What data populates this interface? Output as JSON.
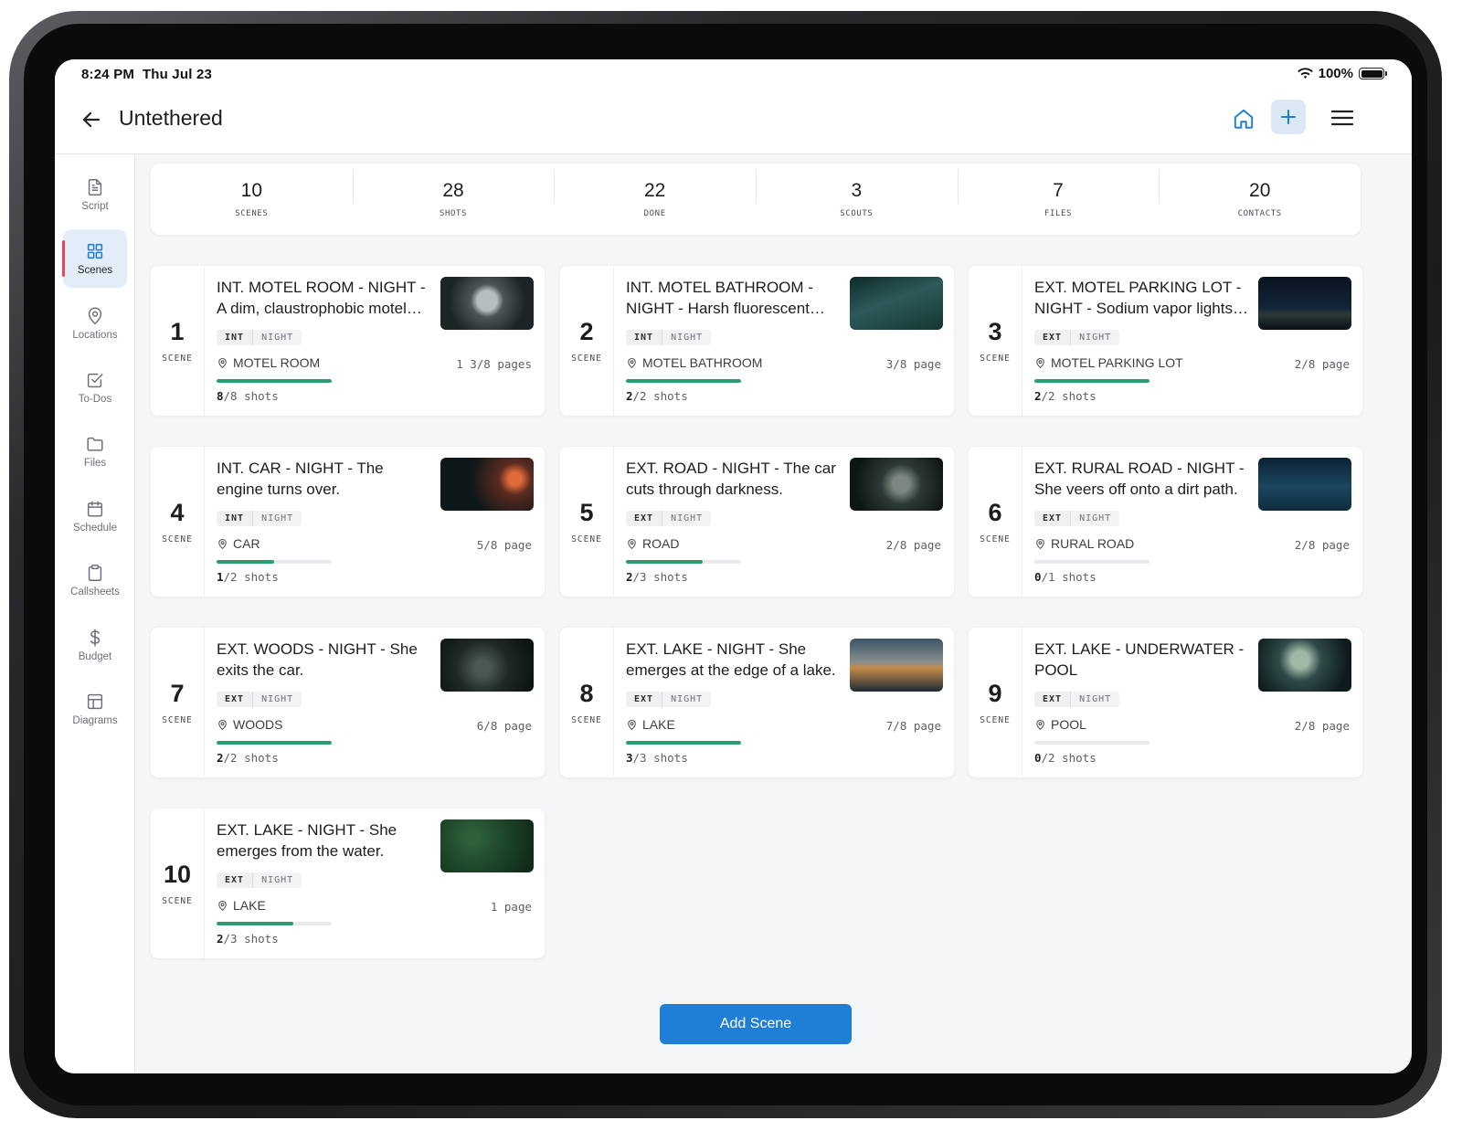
{
  "status": {
    "time": "8:24 PM",
    "date": "Thu Jul 23",
    "battery": "100%"
  },
  "header": {
    "title": "Untethered"
  },
  "sidebar": {
    "items": [
      {
        "label": "Script",
        "icon": "document-icon"
      },
      {
        "label": "Scenes",
        "icon": "grid-icon",
        "active": true
      },
      {
        "label": "Locations",
        "icon": "location-pin-icon"
      },
      {
        "label": "To-Dos",
        "icon": "checkbox-icon"
      },
      {
        "label": "Files",
        "icon": "folder-icon"
      },
      {
        "label": "Schedule",
        "icon": "calendar-icon"
      },
      {
        "label": "Callsheets",
        "icon": "clipboard-icon"
      },
      {
        "label": "Budget",
        "icon": "dollar-icon"
      },
      {
        "label": "Diagrams",
        "icon": "layout-icon"
      }
    ]
  },
  "stats": [
    {
      "value": "10",
      "label": "SCENES"
    },
    {
      "value": "28",
      "label": "SHOTS"
    },
    {
      "value": "22",
      "label": "DONE"
    },
    {
      "value": "3",
      "label": "SCOUTS"
    },
    {
      "value": "7",
      "label": "FILES"
    },
    {
      "value": "20",
      "label": "CONTACTS"
    }
  ],
  "scene_label": "SCENE",
  "scenes": [
    {
      "number": "1",
      "title": "INT. MOTEL ROOM - NIGHT - A dim, claustrophobic motel room.",
      "ie": "INT",
      "tod": "NIGHT",
      "location": "MOTEL ROOM",
      "pages": "1 3/8 pages",
      "shots_done": "8",
      "shots_text": "/8 shots",
      "progress": 1.0
    },
    {
      "number": "2",
      "title": "INT. MOTEL BATHROOM - NIGHT - Harsh fluorescent light.",
      "ie": "INT",
      "tod": "NIGHT",
      "location": "MOTEL BATHROOM",
      "pages": "3/8 page",
      "shots_done": "2",
      "shots_text": "/2 shots",
      "progress": 1.0
    },
    {
      "number": "3",
      "title": "EXT. MOTEL PARKING LOT - NIGHT - Sodium vapor lights flicker.",
      "ie": "EXT",
      "tod": "NIGHT",
      "location": "MOTEL PARKING LOT",
      "pages": "2/8 page",
      "shots_done": "2",
      "shots_text": "/2 shots",
      "progress": 1.0
    },
    {
      "number": "4",
      "title": "INT. CAR - NIGHT - The engine turns over.",
      "ie": "INT",
      "tod": "NIGHT",
      "location": "CAR",
      "pages": "5/8 page",
      "shots_done": "1",
      "shots_text": "/2 shots",
      "progress": 0.5
    },
    {
      "number": "5",
      "title": "EXT. ROAD - NIGHT - The car cuts through darkness.",
      "ie": "EXT",
      "tod": "NIGHT",
      "location": "ROAD",
      "pages": "2/8 page",
      "shots_done": "2",
      "shots_text": "/3 shots",
      "progress": 0.667
    },
    {
      "number": "6",
      "title": "EXT. RURAL ROAD - NIGHT - She veers off onto a dirt path.",
      "ie": "EXT",
      "tod": "NIGHT",
      "location": "RURAL ROAD",
      "pages": "2/8 page",
      "shots_done": "0",
      "shots_text": "/1 shots",
      "progress": 0.0
    },
    {
      "number": "7",
      "title": "EXT. WOODS - NIGHT - She exits the car.",
      "ie": "EXT",
      "tod": "NIGHT",
      "location": "WOODS",
      "pages": "6/8 page",
      "shots_done": "2",
      "shots_text": "/2 shots",
      "progress": 1.0
    },
    {
      "number": "8",
      "title": "EXT. LAKE - NIGHT - She emerges at the edge of a lake.",
      "ie": "EXT",
      "tod": "NIGHT",
      "location": "LAKE",
      "pages": "7/8 page",
      "shots_done": "3",
      "shots_text": "/3 shots",
      "progress": 1.0
    },
    {
      "number": "9",
      "title": "EXT. LAKE - UNDERWATER - POOL",
      "ie": "EXT",
      "tod": "NIGHT",
      "location": "POOL",
      "pages": "2/8 page",
      "shots_done": "0",
      "shots_text": "/2 shots",
      "progress": 0.0
    },
    {
      "number": "10",
      "title": "EXT. LAKE - NIGHT - She emerges from the water.",
      "ie": "EXT",
      "tod": "NIGHT",
      "location": "LAKE",
      "pages": "1 page",
      "shots_done": "2",
      "shots_text": "/3 shots",
      "progress": 0.667
    }
  ],
  "add_scene_label": "Add Scene",
  "colors": {
    "accent": "#1f7fd6",
    "progress": "#2a9d6e",
    "active_indicator": "#e04b63"
  }
}
